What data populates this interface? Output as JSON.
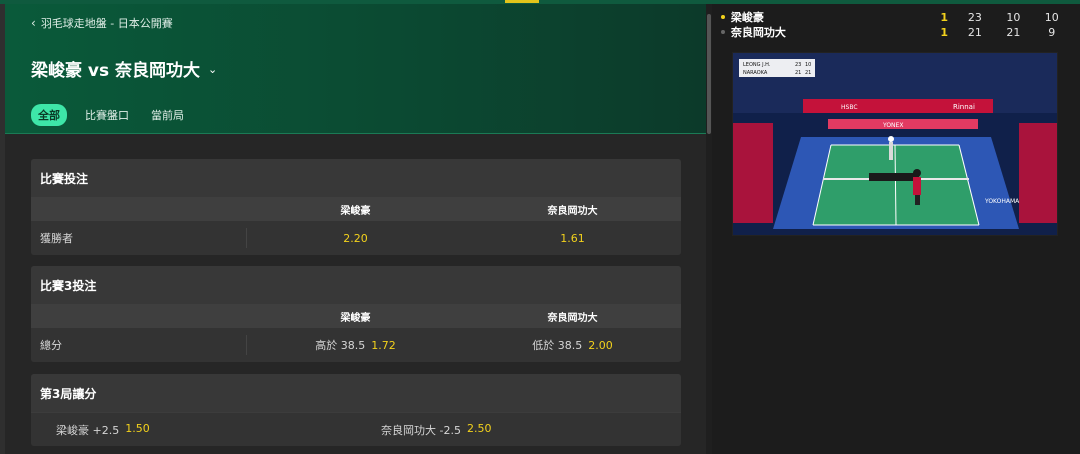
{
  "breadcrumb": {
    "text": "羽毛球走地盤 - 日本公開賽"
  },
  "match": {
    "title": "梁峻豪 vs 奈良岡功大"
  },
  "tabs": [
    {
      "label": "全部",
      "active": true
    },
    {
      "label": "比賽盤口",
      "active": false
    },
    {
      "label": "當前局",
      "active": false
    }
  ],
  "markets": {
    "match_winner": {
      "title": "比賽投注",
      "col1": "梁峻豪",
      "col2": "奈良岡功大",
      "row_label": "獲勝者",
      "odds1": "2.20",
      "odds2": "1.61"
    },
    "game3_total": {
      "title": "比賽3投注",
      "col1": "梁峻豪",
      "col2": "奈良岡功大",
      "row_label": "總分",
      "line1": "高於 38.5",
      "odds1": "1.72",
      "line2": "低於 38.5",
      "odds2": "2.00"
    },
    "game3_handicap": {
      "title": "第3局讓分",
      "line1": "梁峻豪 +2.5",
      "odds1": "1.50",
      "line2": "奈良岡功大 -2.5",
      "odds2": "2.50"
    }
  },
  "scoreboard": {
    "players": [
      {
        "name": "梁峻豪",
        "serving": true,
        "sets": "1",
        "g1": "23",
        "g2": "10",
        "g3": "10"
      },
      {
        "name": "奈良岡功大",
        "serving": false,
        "sets": "1",
        "g1": "21",
        "g2": "21",
        "g3": "9"
      }
    ]
  },
  "video": {
    "overlay": {
      "p1": "LEONG J.H.",
      "p1_s1": "23",
      "p1_s2": "10",
      "p2": "NARAOKA",
      "p2_s1": "21",
      "p2_s2": "21"
    },
    "banners": {
      "brand1": "HSBC",
      "brand2": "Rinnai",
      "brand3": "YONEX",
      "brand4": "YOKOHAMA"
    }
  },
  "colors": {
    "accent_green": "#3ee6a8",
    "odds_yellow": "#f3d21c",
    "header_green": "#0a5a3a"
  }
}
